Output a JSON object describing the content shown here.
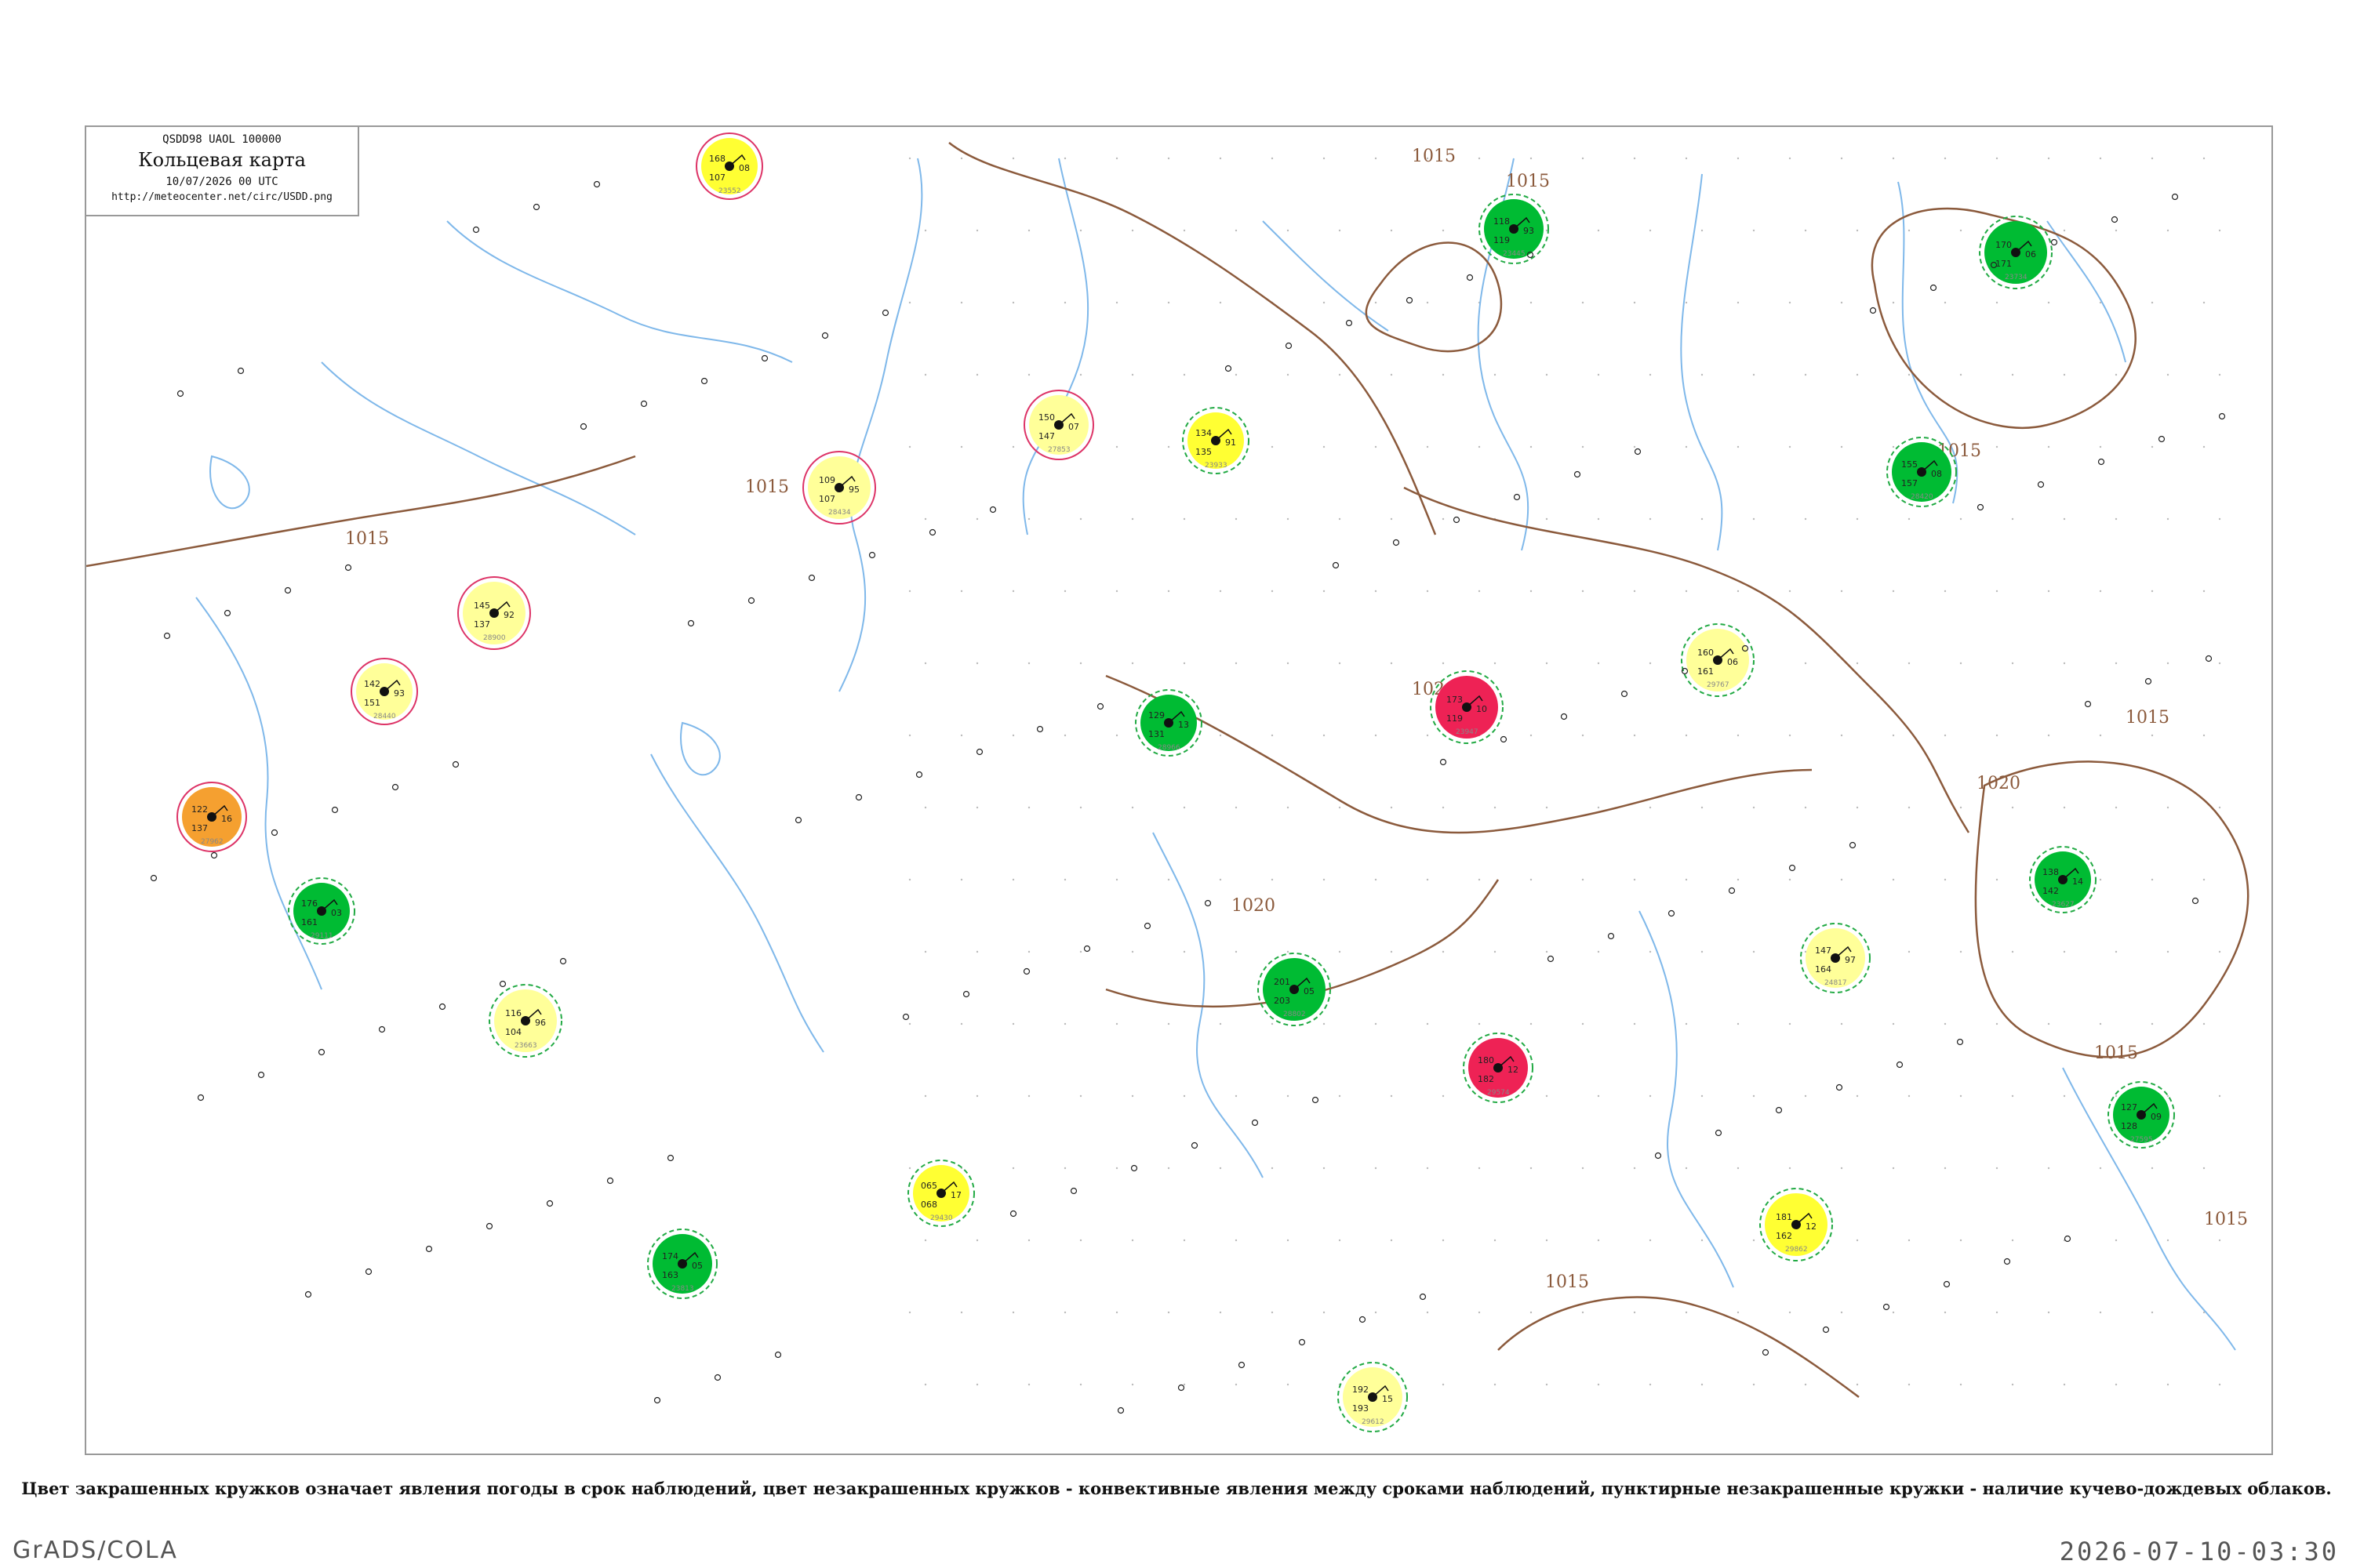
{
  "header": {
    "code": "QSDD98  UAOL  100000",
    "title": "Кольцевая карта",
    "datetime": "10/07/2026 00 UTC",
    "url": "http://meteocenter.net/circ/USDD.png"
  },
  "caption": "Цвет закрашенных кружков означает явления погоды в срок наблюдений, цвет незакрашенных кружков - конвективные явления между сроками наблюдений, пунктирные незакрашенные кружки - наличие кучево-дождевых облаков.",
  "footer": {
    "left": "GrADS/COLA",
    "right": "2026-07-10-03:30"
  },
  "isobar_labels": [
    "1015",
    "1015",
    "1015",
    "1015",
    "1015",
    "1015",
    "1020",
    "1020",
    "1020",
    "1015",
    "1015",
    "1015"
  ],
  "colors": {
    "rain_fill": "#00bb33",
    "light_fill": "#ffff33",
    "faint_fill": "#ffff99",
    "orange_fill": "#f5a030",
    "storm_fill": "#ee2255",
    "isobar": "#8b5a3c",
    "water": "#7fb8ea",
    "convective_ring": "#dd3366",
    "cb_ring": "#22aa44",
    "frame": "#999999"
  },
  "map_legend": {
    "filled": "weather at observation time",
    "open_solid": "convective phenomena between observations",
    "open_dashed": "cumulonimbus clouds present"
  },
  "stations": [
    {
      "t": "168",
      "d": "08",
      "p": "107",
      "id": "23552",
      "kind": "yellow"
    },
    {
      "t": "118",
      "d": "93",
      "p": "119",
      "id": "23445",
      "kind": "green"
    },
    {
      "t": "170",
      "d": "06",
      "p": "171",
      "id": "23734",
      "kind": "green"
    },
    {
      "t": "134",
      "d": "91",
      "p": "135",
      "id": "23933",
      "kind": "yellow"
    },
    {
      "t": "122",
      "d": "16",
      "p": "137",
      "id": "27962",
      "kind": "orange"
    },
    {
      "t": "173",
      "d": "10",
      "p": "119",
      "id": "23947",
      "kind": "red"
    },
    {
      "t": "127",
      "d": "09",
      "p": "128",
      "id": "27595",
      "kind": "green"
    },
    {
      "t": "180",
      "d": "12",
      "p": "182",
      "id": "29574",
      "kind": "red"
    },
    {
      "t": "145",
      "d": "92",
      "p": "137",
      "id": "28900",
      "kind": "faint"
    },
    {
      "t": "065",
      "d": "17",
      "p": "068",
      "id": "29430",
      "kind": "yellow"
    },
    {
      "t": "155",
      "d": "08",
      "p": "157",
      "id": "28420",
      "kind": "green"
    },
    {
      "t": "181",
      "d": "12",
      "p": "162",
      "id": "29862",
      "kind": "yellow"
    },
    {
      "t": "142",
      "d": "93",
      "p": "151",
      "id": "28440",
      "kind": "faint"
    },
    {
      "t": "174",
      "d": "05",
      "p": "163",
      "id": "23813",
      "kind": "green"
    },
    {
      "t": "116",
      "d": "96",
      "p": "104",
      "id": "23663",
      "kind": "faint"
    },
    {
      "t": "129",
      "d": "13",
      "p": "131",
      "id": "28966",
      "kind": "green"
    },
    {
      "t": "150",
      "d": "07",
      "p": "147",
      "id": "27853",
      "kind": "faint"
    },
    {
      "t": "160",
      "d": "06",
      "p": "161",
      "id": "29767",
      "kind": "faint"
    },
    {
      "t": "138",
      "d": "14",
      "p": "142",
      "id": "23627",
      "kind": "green"
    },
    {
      "t": "192",
      "d": "15",
      "p": "193",
      "id": "29612",
      "kind": "faint"
    },
    {
      "t": "109",
      "d": "95",
      "p": "107",
      "id": "28434",
      "kind": "faint"
    },
    {
      "t": "176",
      "d": "03",
      "p": "161",
      "id": "29111",
      "kind": "green"
    },
    {
      "t": "147",
      "d": "97",
      "p": "164",
      "id": "24817",
      "kind": "faint"
    },
    {
      "t": "201",
      "d": "05",
      "p": "203",
      "id": "28802",
      "kind": "green"
    }
  ]
}
